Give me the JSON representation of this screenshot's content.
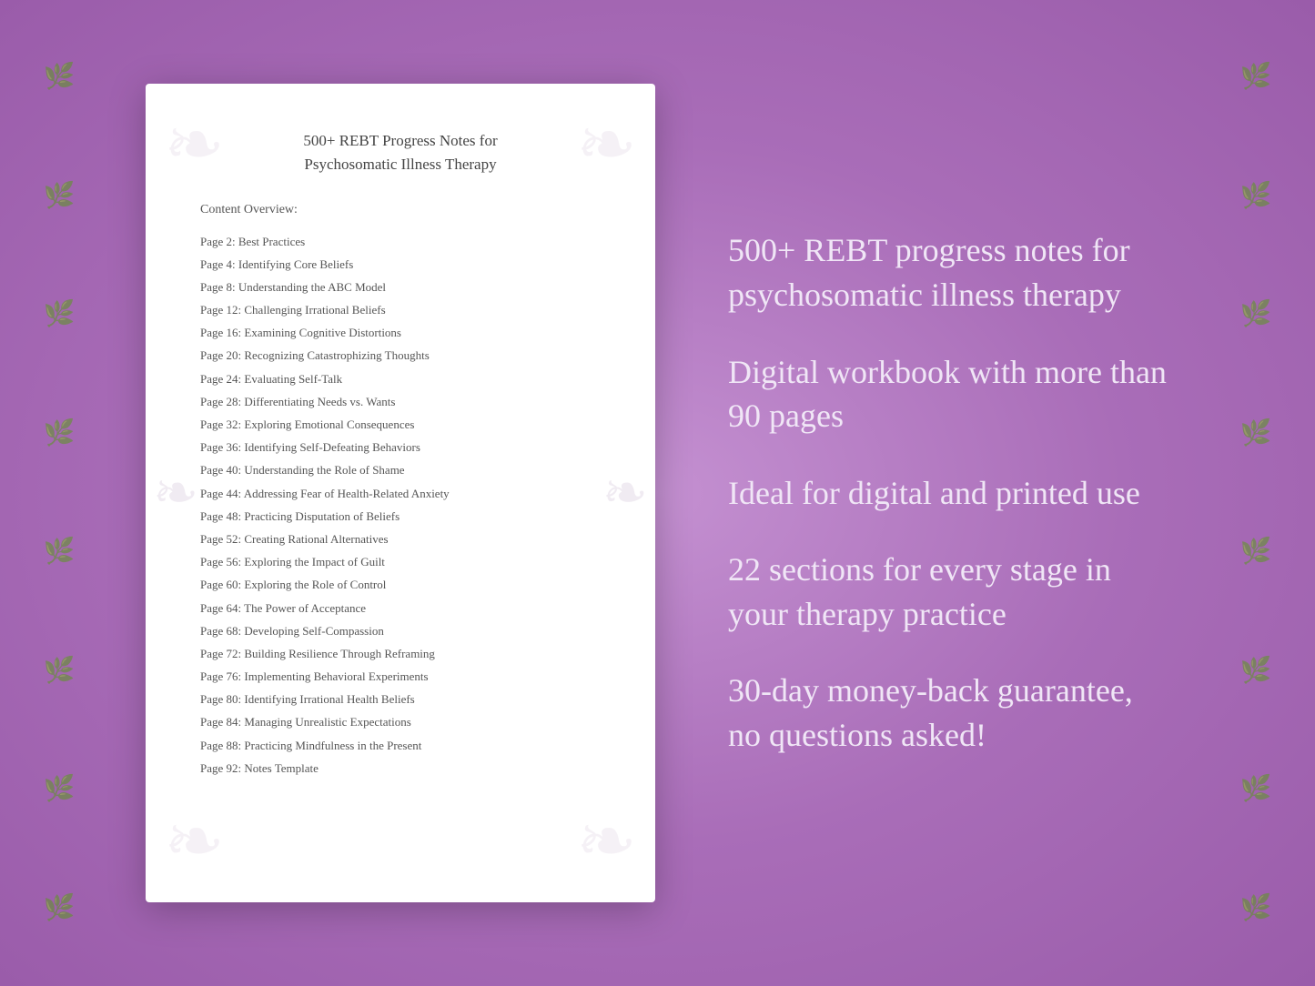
{
  "background_color": "#b47fc0",
  "document": {
    "title_line1": "500+ REBT Progress Notes for",
    "title_line2": "Psychosomatic Illness Therapy",
    "section_label": "Content Overview:",
    "toc_entries": [
      {
        "page": "Page  2:",
        "title": "Best Practices"
      },
      {
        "page": "Page  4:",
        "title": "Identifying Core Beliefs"
      },
      {
        "page": "Page  8:",
        "title": "Understanding the ABC Model"
      },
      {
        "page": "Page 12:",
        "title": "Challenging Irrational Beliefs"
      },
      {
        "page": "Page 16:",
        "title": "Examining Cognitive Distortions"
      },
      {
        "page": "Page 20:",
        "title": "Recognizing Catastrophizing Thoughts"
      },
      {
        "page": "Page 24:",
        "title": "Evaluating Self-Talk"
      },
      {
        "page": "Page 28:",
        "title": "Differentiating Needs vs. Wants"
      },
      {
        "page": "Page 32:",
        "title": "Exploring Emotional Consequences"
      },
      {
        "page": "Page 36:",
        "title": "Identifying Self-Defeating Behaviors"
      },
      {
        "page": "Page 40:",
        "title": "Understanding the Role of Shame"
      },
      {
        "page": "Page 44:",
        "title": "Addressing Fear of Health-Related Anxiety"
      },
      {
        "page": "Page 48:",
        "title": "Practicing Disputation of Beliefs"
      },
      {
        "page": "Page 52:",
        "title": "Creating Rational Alternatives"
      },
      {
        "page": "Page 56:",
        "title": "Exploring the Impact of Guilt"
      },
      {
        "page": "Page 60:",
        "title": "Exploring the Role of Control"
      },
      {
        "page": "Page 64:",
        "title": "The Power of Acceptance"
      },
      {
        "page": "Page 68:",
        "title": "Developing Self-Compassion"
      },
      {
        "page": "Page 72:",
        "title": "Building Resilience Through Reframing"
      },
      {
        "page": "Page 76:",
        "title": "Implementing Behavioral Experiments"
      },
      {
        "page": "Page 80:",
        "title": "Identifying Irrational Health Beliefs"
      },
      {
        "page": "Page 84:",
        "title": "Managing Unrealistic Expectations"
      },
      {
        "page": "Page 88:",
        "title": "Practicing Mindfulness in the Present"
      },
      {
        "page": "Page 92:",
        "title": "Notes Template"
      }
    ]
  },
  "info_panel": {
    "items": [
      "500+ REBT progress notes for psychosomatic illness therapy",
      "Digital workbook with more than 90 pages",
      "Ideal for digital and printed use",
      "22 sections for every stage in your therapy practice",
      "30-day money-back guarantee, no questions asked!"
    ]
  },
  "floral_sprite": "❧"
}
